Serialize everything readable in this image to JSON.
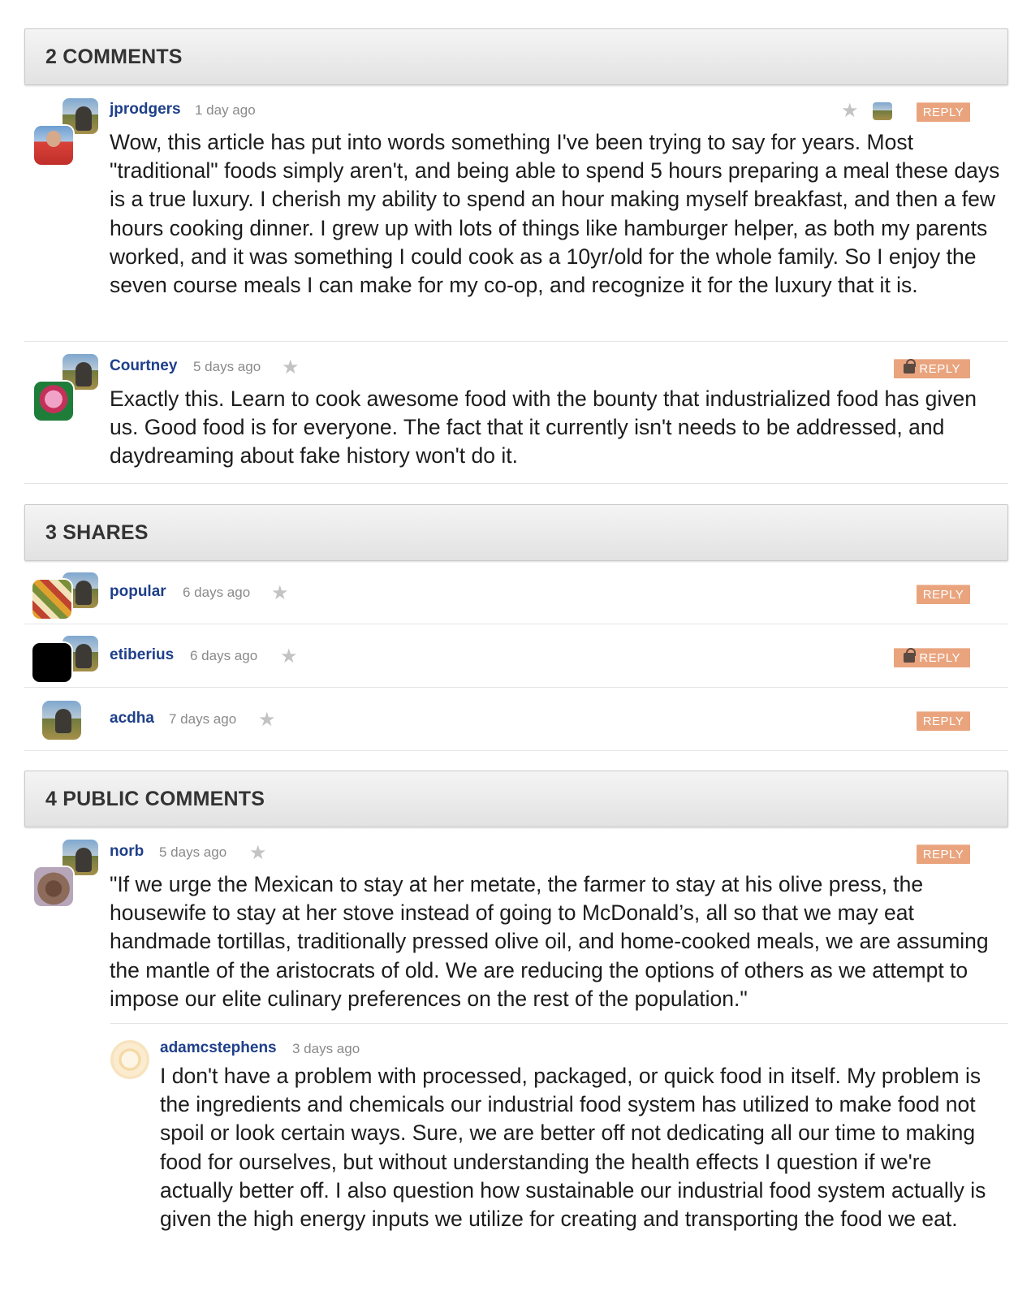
{
  "sections": {
    "comments_header": "2 COMMENTS",
    "shares_header": "3 SHARES",
    "public_header": "4 PUBLIC COMMENTS"
  },
  "reply_label": "REPLY",
  "comments": [
    {
      "user": "jprodgers",
      "time": "1 day ago",
      "text": "Wow, this article has put into words something I've been trying to say for years. Most \"traditional\" foods simply aren't, and being able to spend 5 hours preparing a meal these days is a true luxury. I cherish my ability to spend an hour making myself breakfast, and then a few hours cooking dinner. I grew up with lots of things like hamburger helper, as both my parents worked, and it was something I could cook as a 10yr/old for the whole family. So I enjoy the seven course meals I can make for my co-op, and recognize it for the luxury that it is."
    },
    {
      "user": "Courtney",
      "time": "5 days ago",
      "text": "Exactly this. Learn to cook awesome food with the bounty that industrialized food has given us. Good food is for everyone. The fact that it currently isn't needs to be addressed, and daydreaming about fake history won't do it."
    }
  ],
  "shares": [
    {
      "user": "popular",
      "time": "6 days ago"
    },
    {
      "user": "etiberius",
      "time": "6 days ago"
    },
    {
      "user": "acdha",
      "time": "7 days ago"
    }
  ],
  "public_comments": [
    {
      "user": "norb",
      "time": "5 days ago",
      "text": "\"If we urge the Mexican to stay at her metate, the farmer to stay at his olive press, the housewife to stay at her stove instead of going to McDonald’s, all so that we may eat handmade tortillas, traditionally pressed olive oil, and home-cooked meals, we are assuming the mantle of the aristocrats of old. We are reducing the options of others as we attempt to impose our elite culinary preferences on the rest of the population.\""
    },
    {
      "user": "adamcstephens",
      "time": "3 days ago",
      "text": "I don't have a problem with processed, packaged, or quick food in itself. My problem is the ingredients and chemicals our industrial food system has utilized to make food not spoil or look certain ways. Sure, we are better off not dedicating all our time to making food for ourselves, but without understanding the health effects I question if we're actually better off. I also question how sustainable our industrial food system actually is given the high energy inputs we utilize for creating and transporting the food we eat."
    }
  ],
  "colors": {
    "username": "#1e3f8a",
    "reply_bg": "#e9a47e",
    "header_bg": "#e8e8e8",
    "timestamp": "#8a8a8a"
  },
  "icons": [
    "star-icon",
    "lock-icon",
    "avatar-icon"
  ]
}
